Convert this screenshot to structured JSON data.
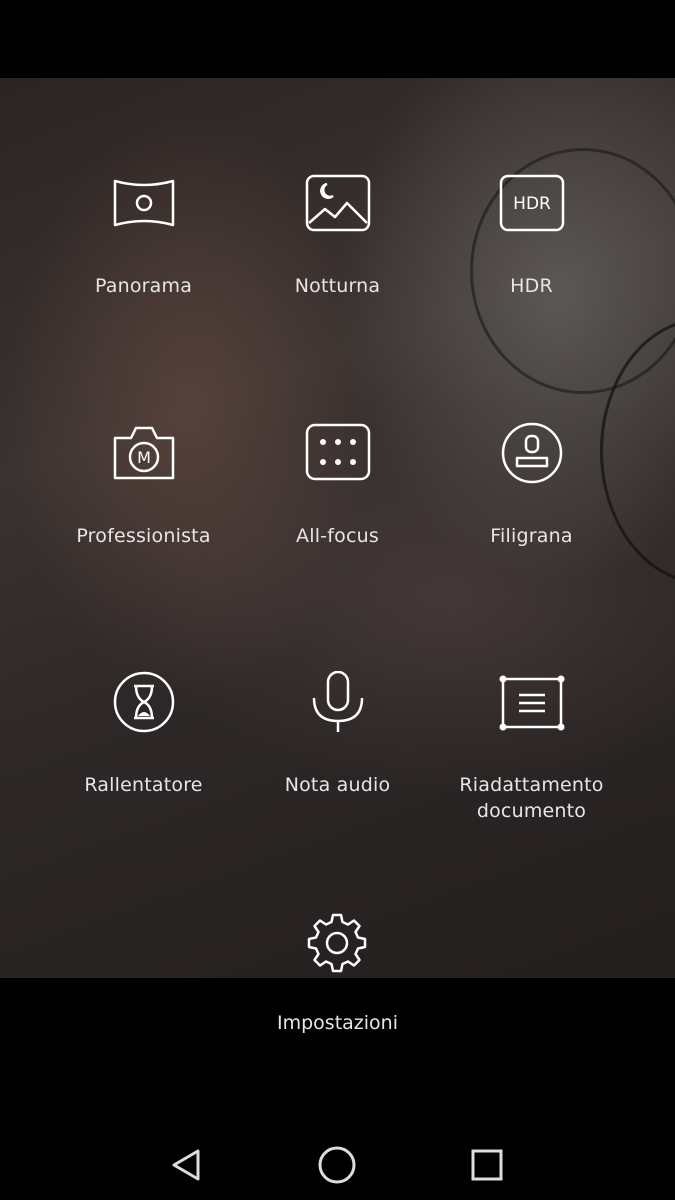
{
  "modes": [
    {
      "label": "Panorama",
      "icon": "panorama-icon"
    },
    {
      "label": "Notturna",
      "icon": "night-landscape-icon"
    },
    {
      "label": "HDR",
      "icon": "hdr-icon",
      "icon_text": "HDR"
    },
    {
      "label": "Professionista",
      "icon": "pro-camera-icon",
      "icon_text": "M"
    },
    {
      "label": "All-focus",
      "icon": "all-focus-icon"
    },
    {
      "label": "Filigrana",
      "icon": "watermark-stamp-icon"
    },
    {
      "label": "Rallentatore",
      "icon": "hourglass-icon"
    },
    {
      "label": "Nota audio",
      "icon": "microphone-icon"
    },
    {
      "label": "Riadattamento documento",
      "label_line1": "Riadattamento",
      "label_line2": "documento",
      "icon": "document-adjust-icon"
    }
  ],
  "settings": {
    "label": "Impostazioni",
    "icon": "gear-icon"
  },
  "nav": {
    "back": "back-icon",
    "home": "home-icon",
    "recents": "recents-icon"
  }
}
